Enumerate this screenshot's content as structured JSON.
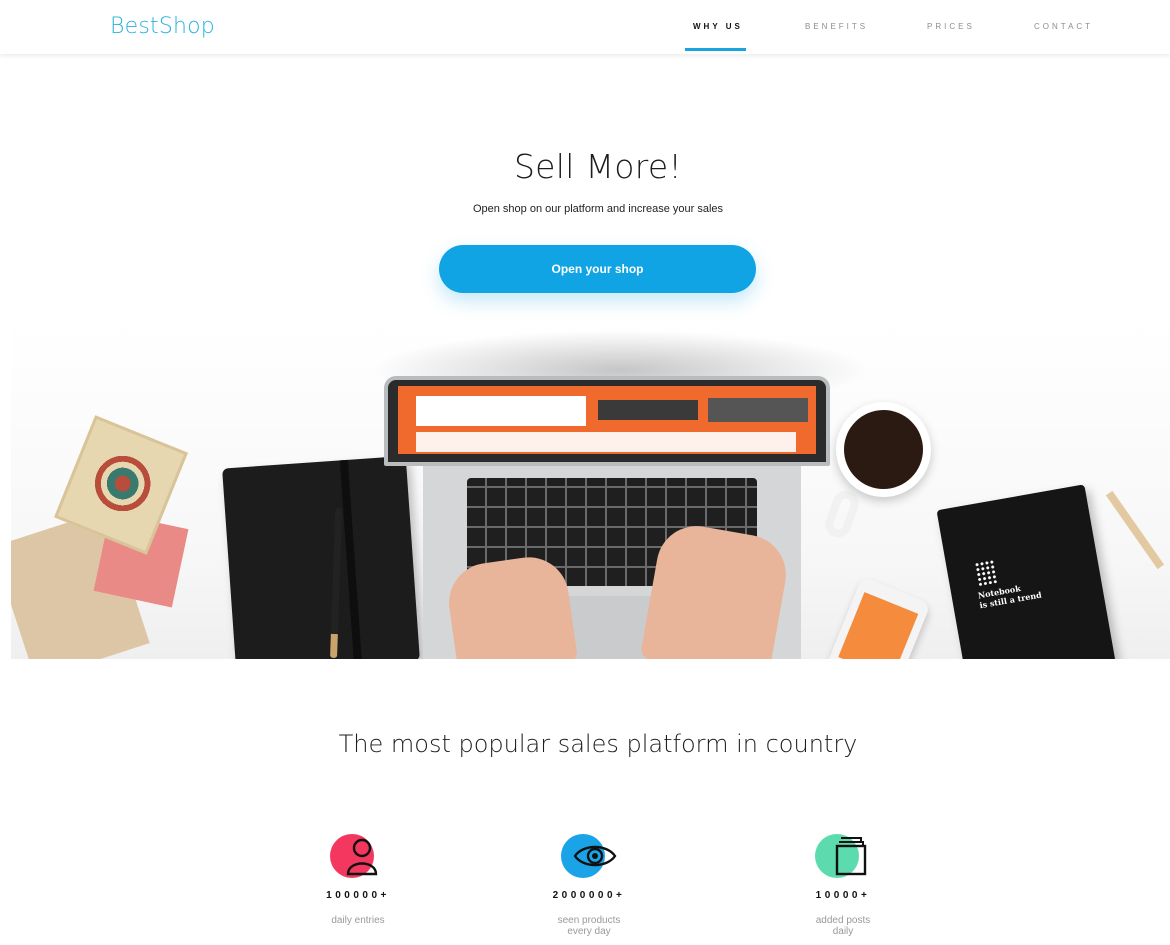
{
  "header": {
    "logo": "BestShop",
    "nav": [
      {
        "label": "WHY US",
        "active": true
      },
      {
        "label": "BENEFITS",
        "active": false
      },
      {
        "label": "PRICES",
        "active": false
      },
      {
        "label": "CONTACT",
        "active": false
      }
    ]
  },
  "hero": {
    "title": "Sell More!",
    "subtitle": "Open shop on our platform and increase your sales",
    "cta_label": "Open your shop",
    "notebook_text": "Notebook\nis still a trend"
  },
  "stats": {
    "title": "The most popular sales platform in country",
    "items": [
      {
        "value": "100000+",
        "label": "daily entries",
        "icon": "user-icon",
        "color": "#f3375f"
      },
      {
        "value": "2000000+",
        "label": "seen products\nevery day",
        "icon": "eye-icon",
        "color": "#1aa3e6"
      },
      {
        "value": "10000+",
        "label": "added posts\ndaily",
        "icon": "posts-icon",
        "color": "#5cdcae"
      }
    ]
  },
  "colors": {
    "accent": "#1ba3dd",
    "cta": "#10a4e4",
    "logo": "#2ab1db"
  }
}
